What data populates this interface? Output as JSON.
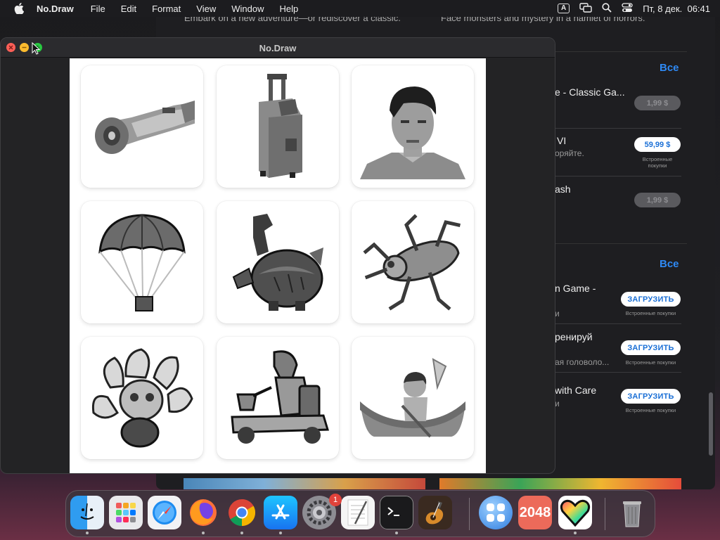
{
  "menubar": {
    "app_name": "No.Draw",
    "items": [
      "File",
      "Edit",
      "Format",
      "View",
      "Window",
      "Help"
    ],
    "input_indicator": "A",
    "datetime": "Пт, 8 дек.  06:41"
  },
  "store": {
    "top_left_text": "Embark on a new adventure—or rediscover a classic.",
    "top_right_text": "Face monsters and mystery in a hamlet of horrors.",
    "see_all": "Все",
    "section1": [
      {
        "title": "e - Classic Ga...",
        "subtitle": "",
        "price": "1,99 $",
        "price_style": "gray",
        "inapp": ""
      },
      {
        "title": "VI",
        "subtitle": "оряйте.",
        "price": "59,99 $",
        "price_style": "price",
        "inapp": "Встроенные\nпокупки"
      },
      {
        "title": "ash",
        "subtitle": "",
        "price": "1,99 $",
        "price_style": "gray",
        "inapp": ""
      }
    ],
    "section2": [
      {
        "title": "n Game -",
        "subtitle": "и",
        "price": "ЗАГРУЗИТЬ",
        "inapp": "Встроенные покупки"
      },
      {
        "title": "ренируй",
        "subtitle": "ая головоло...",
        "price": "ЗАГРУЗИТЬ",
        "inapp": "Встроенные покупки"
      },
      {
        "title": "with Care",
        "subtitle": "и",
        "price": "ЗАГРУЗИТЬ",
        "inapp": "Встроенные покупки"
      }
    ]
  },
  "window": {
    "title": "No.Draw",
    "artworks": [
      {
        "name": "hoverboard"
      },
      {
        "name": "suitcase"
      },
      {
        "name": "boy-portrait"
      },
      {
        "name": "parachute"
      },
      {
        "name": "dragon-pot"
      },
      {
        "name": "grasshopper"
      },
      {
        "name": "peacock"
      },
      {
        "name": "mobility-scooter"
      },
      {
        "name": "canoe-girl"
      }
    ]
  },
  "dock": {
    "apps": [
      "Finder",
      "Launchpad",
      "Safari",
      "Firefox",
      "Chrome",
      "App Store",
      "System Settings",
      "TextEdit",
      "Terminal",
      "GarageBand",
      "Apps Folder",
      "2048",
      "No.Draw",
      "Trash"
    ],
    "settings_badge": "1",
    "game_2048_label": "2048"
  },
  "colors": {
    "accent": "#2f8af5",
    "close": "#fe5f57",
    "minimize": "#febc2e",
    "zoom": "#28c840"
  }
}
